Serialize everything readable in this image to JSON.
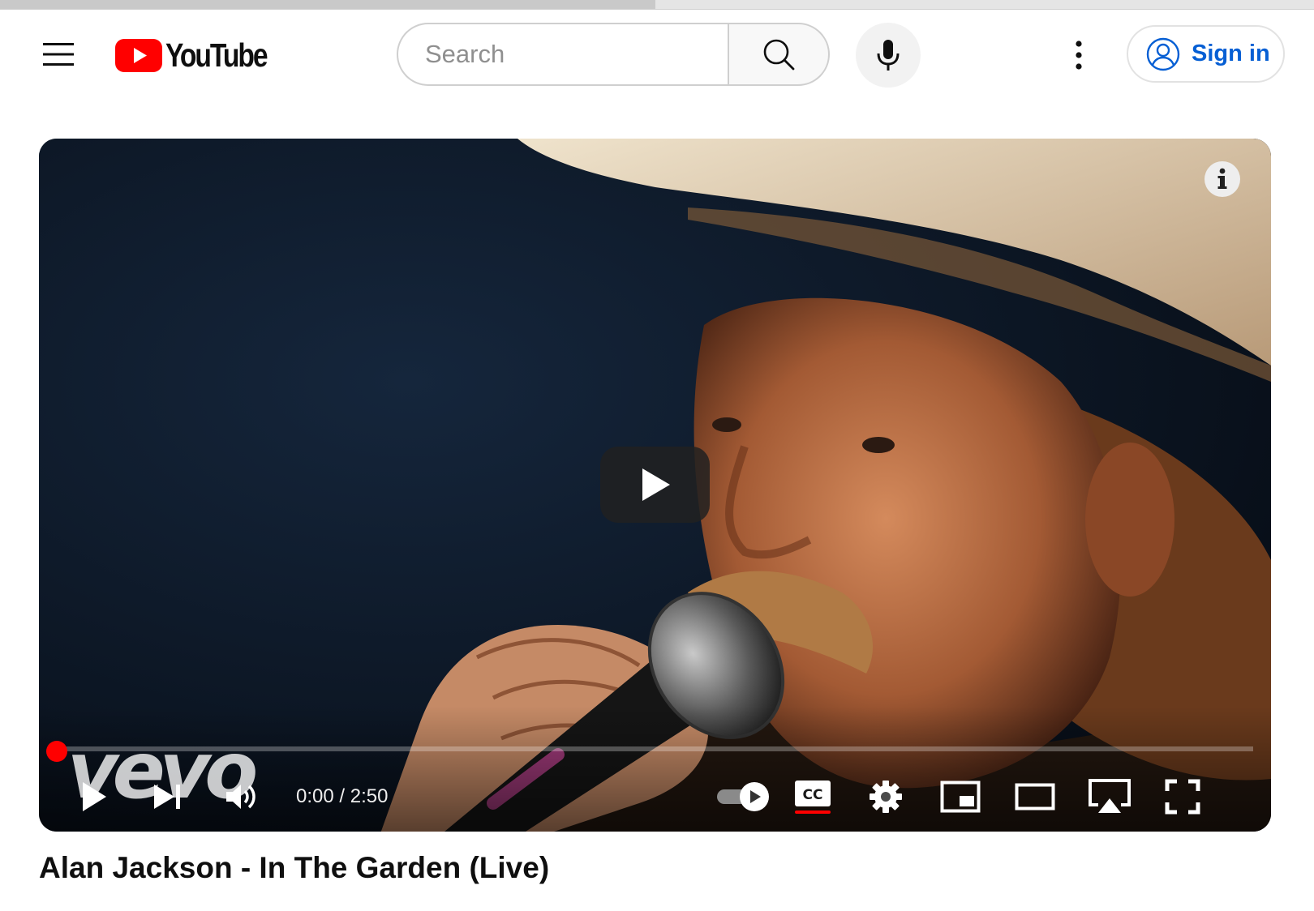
{
  "header": {
    "logo_text": "YouTube",
    "search_placeholder": "Search",
    "signin_label": "Sign in"
  },
  "player": {
    "watermark": "vevo",
    "time_current": "0:00",
    "time_separator": " / ",
    "time_total": "2:50",
    "progress_fraction": 0,
    "captions_on": true,
    "autoplay_on": true
  },
  "video": {
    "title": "Alan Jackson - In The Garden (Live)"
  },
  "colors": {
    "brand_red": "#ff0000",
    "link_blue": "#065fd4"
  },
  "icons": {
    "menu": "hamburger-menu-icon",
    "search": "magnifier-icon",
    "mic": "microphone-icon",
    "more": "vertical-dots-icon",
    "account": "account-circle-icon",
    "info": "info-icon",
    "play": "play-icon",
    "next": "skip-next-icon",
    "volume": "volume-icon",
    "autoplay": "autoplay-toggle-icon",
    "captions": "cc-icon",
    "settings": "gear-icon",
    "miniplayer": "miniplayer-icon",
    "theater": "theater-mode-icon",
    "cast": "airplay-icon",
    "fullscreen": "fullscreen-icon"
  }
}
